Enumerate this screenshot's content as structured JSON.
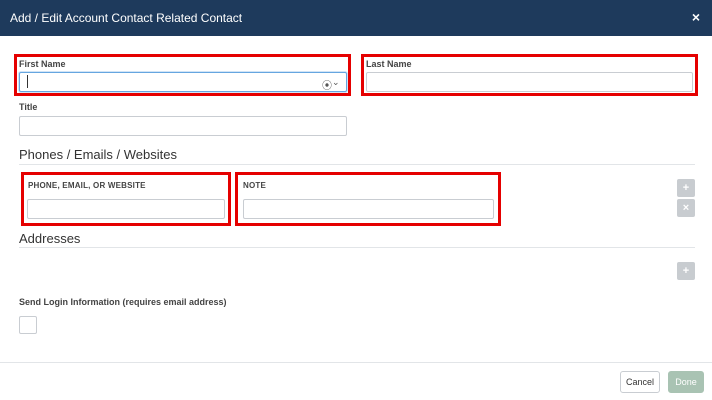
{
  "header": {
    "title": "Add / Edit Account Contact Related Contact",
    "close": "×"
  },
  "fields": {
    "first_name": {
      "label": "First Name",
      "value": ""
    },
    "last_name": {
      "label": "Last Name",
      "value": ""
    },
    "title": {
      "label": "Title",
      "value": ""
    }
  },
  "phones": {
    "section_title": "Phones / Emails / Websites",
    "col_contact": "PHONE, EMAIL, OR WEBSITE",
    "col_note": "NOTE",
    "add_symbol": "+",
    "remove_symbol": "×"
  },
  "addresses": {
    "section_title": "Addresses",
    "add_symbol": "+"
  },
  "login": {
    "label": "Send Login Information (requires email address)"
  },
  "footer": {
    "cancel": "Cancel",
    "done": "Done"
  },
  "icons": {
    "person": "⦿",
    "chevron": "⌄"
  },
  "colors": {
    "header_bg": "#1e3a5c",
    "highlight": "#e50000",
    "done_bg": "#a9c3b3"
  }
}
